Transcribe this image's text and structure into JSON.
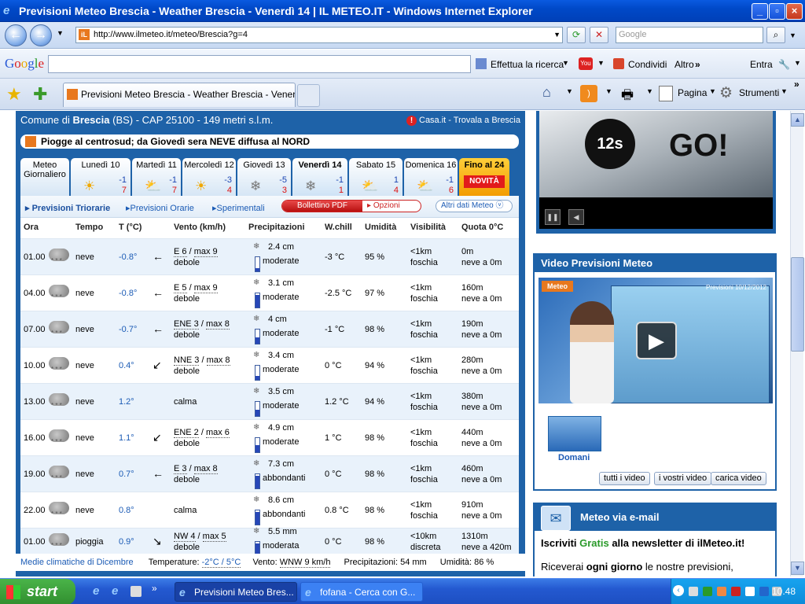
{
  "window": {
    "title": "Previsioni Meteo Brescia - Weather Brescia - Venerdì 14 | IL METEO.IT - Windows Internet Explorer"
  },
  "browser": {
    "url": "http://www.ilmeteo.it/meteo/Brescia?g=4",
    "search_placeholder": "Google",
    "tab_title": "Previsioni Meteo Brescia - Weather Brescia - Venerdì 1...",
    "pagina": "Pagina",
    "strumenti": "Strumenti"
  },
  "google": {
    "logo": "Google",
    "search": "Effettua la ricerca",
    "condividi": "Condividi",
    "altro": "Altro",
    "entra": "Entra"
  },
  "page": {
    "comune": "Comune di",
    "city": "Brescia",
    "details": "(BS) - CAP 25100 - 149 metri s.l.m.",
    "casa": "Casa.it - Trovala a Brescia",
    "headline": "Piogge al centrosud; da Giovedì sera NEVE diffusa al NORD",
    "meteo_giornaliero": "Meteo Giornaliero",
    "days": [
      {
        "label": "Lunedì 10",
        "min": "-1",
        "max": "7"
      },
      {
        "label": "Martedì 11",
        "min": "-1",
        "max": "7"
      },
      {
        "label": "Mercoledì 12",
        "min": "-3",
        "max": "4"
      },
      {
        "label": "Giovedì 13",
        "min": "-5",
        "max": "3"
      },
      {
        "label": "Venerdì 14",
        "min": "-1",
        "max": "1"
      },
      {
        "label": "Sabato 15",
        "min": "1",
        "max": "4"
      },
      {
        "label": "Domenica 16",
        "min": "-1",
        "max": "6"
      }
    ],
    "fino": "Fino al 24",
    "novita": "NOVITÀ",
    "subnav": {
      "triorarie": "Previsioni Triorarie",
      "orarie": "Previsioni Orarie",
      "sperimentali": "Sperimentali",
      "bollettino": "Bollettino PDF",
      "opzioni": "Opzioni",
      "altri": "Altri dati Meteo"
    },
    "headers": {
      "ora": "Ora",
      "tempo": "Tempo",
      "temp": "T (°C)",
      "vento": "Vento (km/h)",
      "prec": "Precipitazioni",
      "wchill": "W.chill",
      "umid": "Umidità",
      "vis": "Visibilità",
      "quota": "Quota 0°C"
    },
    "rows": [
      {
        "ora": "01.00",
        "tempo": "neve",
        "t": "-0.8°",
        "wind_dir": "E 6",
        "wind_max": "max 9",
        "wind_desc": "debole",
        "wind_arrow": "←",
        "prec": "2.4 cm",
        "prec_desc": "moderate",
        "prec_level": 0.25,
        "wc": "-3 °C",
        "um": "95 %",
        "vis": "<1km",
        "vis2": "foschia",
        "q": "0m",
        "q2": "neve a 0m"
      },
      {
        "ora": "04.00",
        "tempo": "neve",
        "t": "-0.8°",
        "wind_dir": "E 5",
        "wind_max": "max 9",
        "wind_desc": "debole",
        "wind_arrow": "←",
        "prec": "3.1 cm",
        "prec_desc": "moderate",
        "prec_level": 0.9,
        "wc": "-2.5 °C",
        "um": "97 %",
        "vis": "<1km",
        "vis2": "foschia",
        "q": "160m",
        "q2": "neve a 0m"
      },
      {
        "ora": "07.00",
        "tempo": "neve",
        "t": "-0.7°",
        "wind_dir": "ENE 3",
        "wind_max": "max 8",
        "wind_desc": "debole",
        "wind_arrow": "←",
        "prec": "4 cm",
        "prec_desc": "moderate",
        "prec_level": 0.45,
        "wc": "-1 °C",
        "um": "98 %",
        "vis": "<1km",
        "vis2": "foschia",
        "q": "190m",
        "q2": "neve a 0m"
      },
      {
        "ora": "10.00",
        "tempo": "neve",
        "t": "0.4°",
        "wind_dir": "NNE 3",
        "wind_max": "max 8",
        "wind_desc": "debole",
        "wind_arrow": "↙",
        "prec": "3.4 cm",
        "prec_desc": "moderate",
        "prec_level": 0.3,
        "wc": "0 °C",
        "um": "94 %",
        "vis": "<1km",
        "vis2": "foschia",
        "q": "280m",
        "q2": "neve a 0m"
      },
      {
        "ora": "13.00",
        "tempo": "neve",
        "t": "1.2°",
        "wind_dir": "",
        "wind_max": "",
        "wind_desc": "calma",
        "wind_arrow": "",
        "prec": "3.5 cm",
        "prec_desc": "moderate",
        "prec_level": 0.45,
        "wc": "1.2 °C",
        "um": "94 %",
        "vis": "<1km",
        "vis2": "foschia",
        "q": "380m",
        "q2": "neve a 0m"
      },
      {
        "ora": "16.00",
        "tempo": "neve",
        "t": "1.1°",
        "wind_dir": "ENE 2",
        "wind_max": "max 6",
        "wind_desc": "debole",
        "wind_arrow": "↙",
        "prec": "4.9 cm",
        "prec_desc": "moderate",
        "prec_level": 0.5,
        "wc": "1 °C",
        "um": "98 %",
        "vis": "<1km",
        "vis2": "foschia",
        "q": "440m",
        "q2": "neve a 0m"
      },
      {
        "ora": "19.00",
        "tempo": "neve",
        "t": "0.7°",
        "wind_dir": "E 3",
        "wind_max": "max 8",
        "wind_desc": "debole",
        "wind_arrow": "←",
        "prec": "7.3 cm",
        "prec_desc": "abbondanti",
        "prec_level": 0.9,
        "wc": "0 °C",
        "um": "98 %",
        "vis": "<1km",
        "vis2": "foschia",
        "q": "460m",
        "q2": "neve a 0m"
      },
      {
        "ora": "22.00",
        "tempo": "neve",
        "t": "0.8°",
        "wind_dir": "",
        "wind_max": "",
        "wind_desc": "calma",
        "wind_arrow": "",
        "prec": "8.6 cm",
        "prec_desc": "abbondanti",
        "prec_level": 0.9,
        "wc": "0.8 °C",
        "um": "98 %",
        "vis": "<1km",
        "vis2": "foschia",
        "q": "910m",
        "q2": "neve a 0m"
      },
      {
        "ora": "01.00",
        "tempo": "pioggia",
        "t": "0.9°",
        "wind_dir": "NW 4",
        "wind_max": "max 5",
        "wind_desc": "debole",
        "wind_arrow": "↘",
        "prec": "5.5 mm",
        "prec_desc": "moderata",
        "prec_level": 0.9,
        "wc": "0 °C",
        "um": "98 %",
        "vis": "<10km",
        "vis2": "discreta",
        "q": "1310m",
        "q2": "neve a 420m"
      }
    ],
    "footer": {
      "medie": "Medie climatiche di Dicembre",
      "temp_label": "Temperature:",
      "temp_val": "-2°C / 5°C",
      "vento_label": "Vento:",
      "vento_val": "WNW 9 km/h",
      "prec": "Precipitazioni: 54 mm",
      "umid": "Umidità: 86 %"
    }
  },
  "sidebar": {
    "ad_timer": "12s",
    "ad_go": "GO!",
    "video_title": "Video Previsioni Meteo",
    "video_date": "Previsioni 10/12/2012",
    "video_logo": "Meteo",
    "domani": "Domani",
    "tutti": "tutti i video",
    "vostri": "i vostri video",
    "carica": "carica video",
    "mail_title": "Meteo via e-mail",
    "mail_l1a": "Iscriviti ",
    "mail_l1b": "Gratis",
    "mail_l1c": " alla newsletter di ilMeteo.it!",
    "mail_l2a": "Riceverai ",
    "mail_l2b": "ogni giorno",
    "mail_l2c": " le nostre previsioni,"
  },
  "taskbar": {
    "start": "start",
    "task1": "Previsioni Meteo Bres...",
    "task2": "fofana - Cerca con G...",
    "clock": "10.48"
  }
}
